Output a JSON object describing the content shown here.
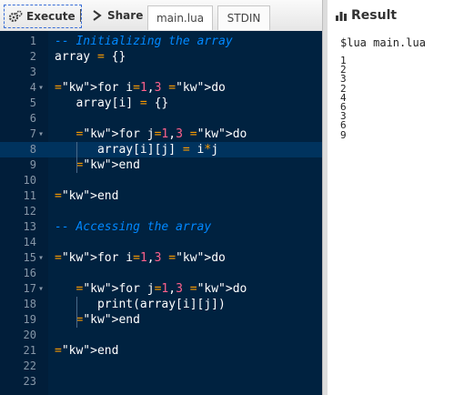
{
  "toolbar": {
    "execute_label": "Execute",
    "share_label": "Share",
    "tabs": [
      {
        "label": "main.lua",
        "active": true
      },
      {
        "label": "STDIN",
        "active": false
      }
    ]
  },
  "editor": {
    "lines": [
      {
        "n": "1",
        "fold": "",
        "code": "-- Initializing the array"
      },
      {
        "n": "2",
        "fold": "",
        "code": "array = {}"
      },
      {
        "n": "3",
        "fold": "",
        "code": ""
      },
      {
        "n": "4",
        "fold": "▾",
        "code": "for i=1,3 do"
      },
      {
        "n": "5",
        "fold": "",
        "code": "   array[i] = {}"
      },
      {
        "n": "6",
        "fold": "",
        "code": ""
      },
      {
        "n": "7",
        "fold": "▾",
        "code": "   for j=1,3 do"
      },
      {
        "n": "8",
        "fold": "",
        "code": "      array[i][j] = i*j"
      },
      {
        "n": "9",
        "fold": "",
        "code": "   end"
      },
      {
        "n": "10",
        "fold": "",
        "code": ""
      },
      {
        "n": "11",
        "fold": "",
        "code": "end"
      },
      {
        "n": "12",
        "fold": "",
        "code": ""
      },
      {
        "n": "13",
        "fold": "",
        "code": "-- Accessing the array"
      },
      {
        "n": "14",
        "fold": "",
        "code": ""
      },
      {
        "n": "15",
        "fold": "▾",
        "code": "for i=1,3 do"
      },
      {
        "n": "16",
        "fold": "",
        "code": ""
      },
      {
        "n": "17",
        "fold": "▾",
        "code": "   for j=1,3 do"
      },
      {
        "n": "18",
        "fold": "",
        "code": "      print(array[i][j])"
      },
      {
        "n": "19",
        "fold": "",
        "code": "   end"
      },
      {
        "n": "20",
        "fold": "",
        "code": ""
      },
      {
        "n": "21",
        "fold": "",
        "code": "end"
      },
      {
        "n": "22",
        "fold": "",
        "code": ""
      },
      {
        "n": "23",
        "fold": "",
        "code": ""
      }
    ],
    "active_line": 8
  },
  "result": {
    "title": "Result",
    "command": "$lua main.lua",
    "output": [
      "1",
      "2",
      "3",
      "2",
      "4",
      "6",
      "3",
      "6",
      "9"
    ]
  },
  "colors": {
    "editor_bg": "#002240",
    "keyword": "#ff9d00",
    "number": "#ff628c",
    "comment": "#0088ff"
  }
}
